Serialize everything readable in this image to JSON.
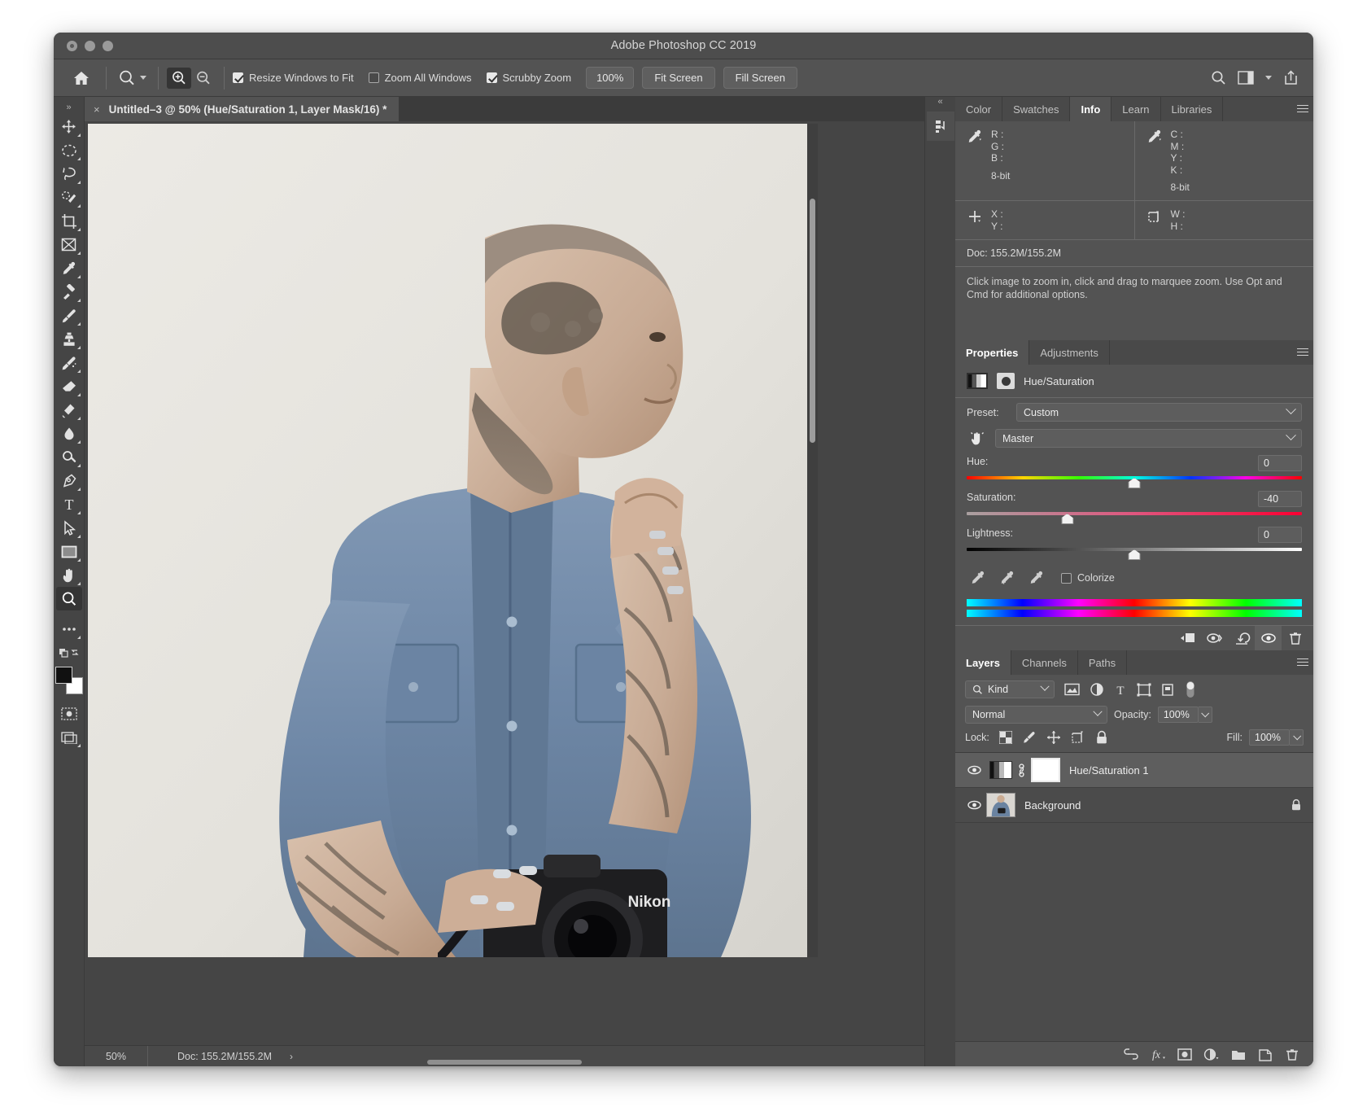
{
  "window": {
    "title": "Adobe Photoshop CC 2019"
  },
  "options_bar": {
    "home_icon": "home-icon",
    "tool_icon": "zoom-tool-icon",
    "zoom_in_icon": "zoom-in-icon",
    "zoom_out_icon": "zoom-out-icon",
    "checkboxes": [
      {
        "label": "Resize Windows to Fit",
        "checked": true
      },
      {
        "label": "Zoom All Windows",
        "checked": false
      },
      {
        "label": "Scrubby Zoom",
        "checked": true
      }
    ],
    "buttons": [
      "100%",
      "Fit Screen",
      "Fill Screen"
    ],
    "right_icons": [
      "search-icon",
      "workspace-icon",
      "chevron-down-icon",
      "share-icon"
    ]
  },
  "document_tab": {
    "close_label": "×",
    "title": "Untitled–3 @ 50% (Hue/Saturation 1, Layer Mask/16) *"
  },
  "status_bar": {
    "zoom": "50%",
    "doc": "Doc: 155.2M/155.2M",
    "arrow": "›"
  },
  "toolbar": {
    "collapse": "»",
    "tools": [
      "move-tool",
      "elliptical-marquee-tool",
      "lasso-tool",
      "quick-selection-tool",
      "crop-tool",
      "frame-tool",
      "eyedropper-tool",
      "healing-brush-tool",
      "brush-tool",
      "clone-stamp-tool",
      "history-brush-tool",
      "eraser-tool",
      "gradient-tool",
      "blur-tool",
      "dodge-tool",
      "pen-tool",
      "type-tool",
      "path-selection-tool",
      "rectangle-tool",
      "hand-tool",
      "zoom-tool"
    ],
    "selected_tool": "zoom-tool",
    "more_tools": "•••",
    "foreground_color": "#111111",
    "background_color": "#ffffff"
  },
  "info_panel": {
    "tabs": [
      "Color",
      "Swatches",
      "Info",
      "Learn",
      "Libraries"
    ],
    "active_tab": "Info",
    "rgb_labels": [
      "R :",
      "G :",
      "B :"
    ],
    "rgb_depth": "8-bit",
    "cmyk_labels": [
      "C :",
      "M :",
      "Y :",
      "K :"
    ],
    "cmyk_depth": "8-bit",
    "xy_labels": [
      "X :",
      "Y :"
    ],
    "wh_labels": [
      "W :",
      "H :"
    ],
    "doc_line": "Doc: 155.2M/155.2M",
    "hint": "Click image to zoom in, click and drag to marquee zoom.  Use Opt and Cmd for additional options."
  },
  "properties_panel": {
    "tabs": [
      "Properties",
      "Adjustments"
    ],
    "active_tab": "Properties",
    "header_title": "Hue/Saturation",
    "preset_label": "Preset:",
    "preset_value": "Custom",
    "channel_value": "Master",
    "sliders": [
      {
        "label": "Hue:",
        "value": "0",
        "thumb_pct": 50
      },
      {
        "label": "Saturation:",
        "value": "-40",
        "thumb_pct": 30
      },
      {
        "label": "Lightness:",
        "value": "0",
        "thumb_pct": 50
      }
    ],
    "colorize_label": "Colorize",
    "colorize_checked": false,
    "eyedropper_icons": [
      "eyedropper-icon",
      "eyedropper-plus-icon",
      "eyedropper-minus-icon"
    ],
    "footer_icons": [
      "clip-to-layer-icon",
      "view-previous-state-icon",
      "reset-icon",
      "toggle-visibility-icon",
      "delete-icon"
    ]
  },
  "layers_panel": {
    "tabs": [
      "Layers",
      "Channels",
      "Paths"
    ],
    "active_tab": "Layers",
    "filter_value": "Kind",
    "filter_icons": [
      "pixel-filter-icon",
      "adjustment-filter-icon",
      "type-filter-icon",
      "shape-filter-icon",
      "smart-object-filter-icon",
      "filter-toggle-icon"
    ],
    "blend_mode": "Normal",
    "opacity_label": "Opacity:",
    "opacity_value": "100%",
    "lock_label": "Lock:",
    "lock_icons": [
      "lock-transparent-icon",
      "lock-image-icon",
      "lock-position-icon",
      "lock-artboard-icon",
      "lock-all-icon"
    ],
    "fill_label": "Fill:",
    "fill_value": "100%",
    "rows": [
      {
        "name": "Hue/Saturation 1",
        "type": "adjustment",
        "visible": true,
        "selected": true,
        "locked": false
      },
      {
        "name": "Background",
        "type": "image",
        "visible": true,
        "selected": false,
        "locked": true
      }
    ],
    "footer_icons": [
      "link-layers-icon",
      "add-layer-style-icon",
      "add-layer-mask-icon",
      "new-adjustment-layer-icon",
      "new-group-icon",
      "new-layer-icon",
      "delete-layer-icon"
    ]
  },
  "colors": {
    "window_chrome": "#4d4d4d",
    "panel_bg": "#535353",
    "app_bg": "#454545",
    "accent_text": "#ffffff"
  }
}
